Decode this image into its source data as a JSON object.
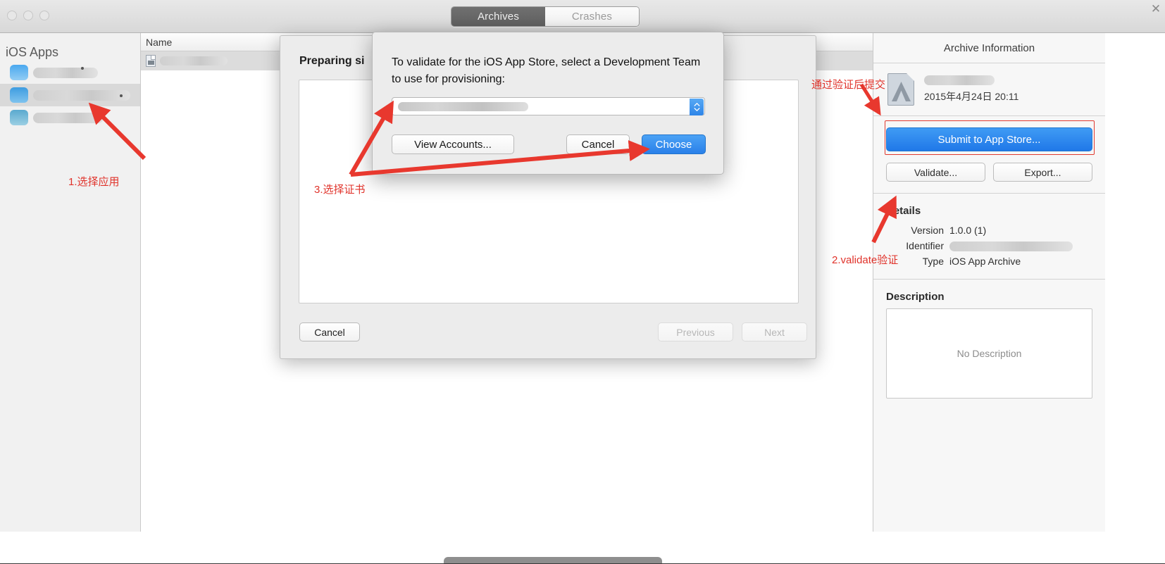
{
  "window": {
    "close_glyph": "✕",
    "tabs": [
      {
        "label": "Archives",
        "selected": true
      },
      {
        "label": "Crashes",
        "selected": false
      }
    ]
  },
  "sidebar": {
    "title": "iOS Apps",
    "items": [
      {
        "label": "",
        "redacted": true,
        "selected": false
      },
      {
        "label": "",
        "redacted": true,
        "selected": true
      },
      {
        "label": "",
        "redacted": true,
        "selected": false
      }
    ]
  },
  "archive_list": {
    "column_header": "Name",
    "rows": [
      {
        "name": "",
        "redacted": true,
        "selected": true
      }
    ]
  },
  "right_panel": {
    "header": "Archive Information",
    "archive": {
      "name": "",
      "date": "2015年4月24日 20:11"
    },
    "submit_label": "Submit to App Store...",
    "validate_label": "Validate...",
    "export_label": "Export...",
    "details_title": "Details",
    "details": [
      {
        "key": "Version",
        "value": "1.0.0 (1)"
      },
      {
        "key": "Identifier",
        "value": "",
        "redacted": true
      },
      {
        "key": "Type",
        "value": "iOS App Archive"
      }
    ],
    "description_title": "Description",
    "description_placeholder": "No Description"
  },
  "sheet": {
    "title": "Preparing si",
    "cancel_label": "Cancel",
    "previous_label": "Previous",
    "next_label": "Next"
  },
  "alert": {
    "message": "To validate for the iOS App Store, select a Development Team to use for provisioning:",
    "team_value": "",
    "view_accounts_label": "View Accounts...",
    "cancel_label": "Cancel",
    "choose_label": "Choose"
  },
  "annotations": [
    {
      "id": "step1",
      "text": "1.选择应用"
    },
    {
      "id": "step2",
      "text": "2.validate验证"
    },
    {
      "id": "step3",
      "text": "3.选择证书"
    },
    {
      "id": "step4",
      "text": "通过验证后提交"
    }
  ],
  "colors": {
    "accent_blue": "#2a80e9",
    "annotation_red": "#e0322a",
    "selection_gray": "#d9d9d9"
  }
}
